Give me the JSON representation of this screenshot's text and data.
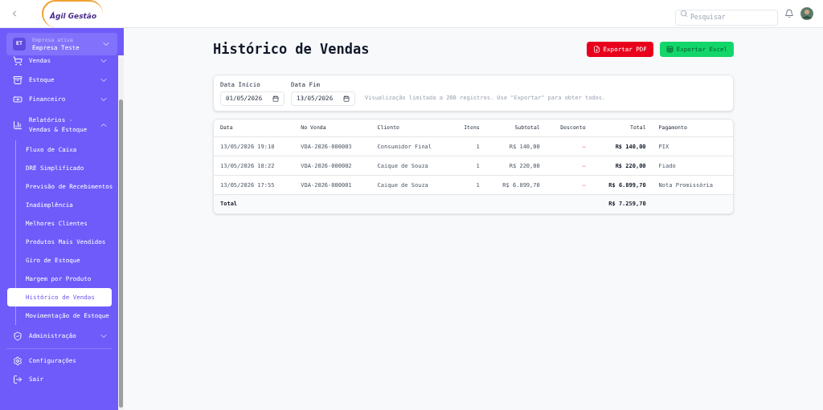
{
  "header": {
    "logo": "Ágil Gestão",
    "search": {
      "placeholder": "Pesquisar"
    }
  },
  "company": {
    "badge": "ET",
    "caption": "Empresa ativa",
    "name": "Empresa Teste"
  },
  "sidebar": {
    "items": [
      {
        "label": "Vendas",
        "expanded": false
      },
      {
        "label": "Estoque",
        "expanded": false
      },
      {
        "label": "Financeiro",
        "expanded": false
      },
      {
        "label": "Relatórios - Vendas & Estoque",
        "expanded": true,
        "children": [
          {
            "label": "Fluxo de Caixa",
            "selected": false
          },
          {
            "label": "DRE Simplificado",
            "selected": false
          },
          {
            "label": "Previsão de Recebimentos",
            "selected": false
          },
          {
            "label": "Inadimplência",
            "selected": false
          },
          {
            "label": "Melhores Clientes",
            "selected": false
          },
          {
            "label": "Produtos Mais Vendidos",
            "selected": false
          },
          {
            "label": "Giro de Estoque",
            "selected": false
          },
          {
            "label": "Margem por Produto",
            "selected": false
          },
          {
            "label": "Histórico de Vendas",
            "selected": true
          },
          {
            "label": "Movimentação de Estoque",
            "selected": false
          }
        ]
      },
      {
        "label": "Administração",
        "expanded": false
      }
    ],
    "footer": [
      {
        "label": "Configurações"
      },
      {
        "label": "Sair"
      }
    ]
  },
  "page": {
    "title": "Histórico de Vendas",
    "buttons": [
      {
        "label": "Exportar PDF",
        "kind": "pdf"
      },
      {
        "label": "Exportar Excel",
        "kind": "excel"
      }
    ]
  },
  "filters": {
    "fields": [
      {
        "label": "Data Início",
        "value": "01/05/2026"
      },
      {
        "label": "Data Fim",
        "value": "13/05/2026"
      }
    ],
    "note": "Visualização limitada a 200 registros. Use \"Exportar\" para obter todos."
  },
  "table": {
    "columns": [
      "Data",
      "No Venda",
      "Cliente",
      "Itens",
      "Subtotal",
      "Desconto",
      "Total",
      "Pagamento"
    ],
    "rows": [
      [
        "13/05/2026 19:18",
        "VDA-2026-000003",
        "Consumidor Final",
        "1",
        "R$ 140,00",
        "—",
        "R$ 140,00",
        "PIX"
      ],
      [
        "13/05/2026 18:22",
        "VDA-2026-000002",
        "Caique de Souza",
        "1",
        "R$ 220,00",
        "—",
        "R$ 220,00",
        "Fiado"
      ],
      [
        "13/05/2026 17:55",
        "VDA-2026-000001",
        "Caique de Souza",
        "1",
        "R$ 6.899,70",
        "—",
        "R$ 6.899,70",
        "Nota Promissória"
      ]
    ],
    "footer": {
      "label": "Total",
      "total": "R$ 7.259,70"
    }
  }
}
